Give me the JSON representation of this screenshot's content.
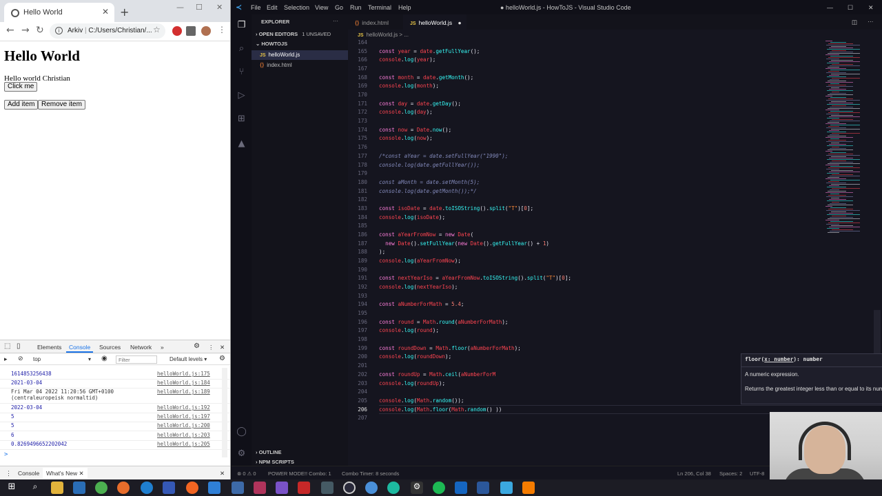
{
  "browser": {
    "tab_title": "Hello World",
    "address_prefix": "Arkiv",
    "address_separator": "|",
    "address_path": "C:/Users/Christian/...",
    "page": {
      "heading": "Hello World",
      "paragraph": "Hello world Christian",
      "click_button": "Click me",
      "add_button": "Add item",
      "remove_button": "Remove item"
    },
    "devtools": {
      "tabs": [
        "Elements",
        "Console",
        "Sources",
        "Network"
      ],
      "context": "top",
      "filter_placeholder": "Filter",
      "levels": "Default levels",
      "logs": [
        {
          "message": "1614853256438",
          "source": "helloWorld.js:175"
        },
        {
          "message": "2021-03-04",
          "source": "helloWorld.js:184"
        },
        {
          "message": "Fri Mar 04 2022 11:20:56 GMT+0100",
          "message2": "(centraleuropeisk normaltid)",
          "source": "helloWorld.js:189"
        },
        {
          "message": "2022-03-04",
          "source": "helloWorld.js:192"
        },
        {
          "message": "5",
          "source": "helloWorld.js:197"
        },
        {
          "message": "5",
          "source": "helloWorld.js:200"
        },
        {
          "message": "6",
          "source": "helloWorld.js:203"
        },
        {
          "message": "0.8269496652202042",
          "source": "helloWorld.js:205"
        }
      ],
      "prompt": ">",
      "drawer_tabs": [
        "Console",
        "What's New"
      ]
    }
  },
  "vscode": {
    "menu": [
      "File",
      "Edit",
      "Selection",
      "View",
      "Go",
      "Run",
      "Terminal",
      "Help"
    ],
    "title": "● helloWorld.js - HowToJS - Visual Studio Code",
    "sidebar": {
      "header": "EXPLORER",
      "open_editors": "OPEN EDITORS",
      "unsaved": "1 UNSAVED",
      "folder": "HOWTOJS",
      "files": [
        {
          "name": "helloWorld.js",
          "type": "JS"
        },
        {
          "name": "index.html",
          "type": "HTML"
        }
      ],
      "outline": "OUTLINE",
      "npm_scripts": "NPM SCRIPTS"
    },
    "tabs": [
      {
        "name": "index.html"
      },
      {
        "name": "helloWorld.js",
        "dirty": "●"
      }
    ],
    "breadcrumb": "helloWorld.js > ...",
    "hover": {
      "sig_pre": "floor(",
      "sig_param": "x: number",
      "sig_post": "): number",
      "param_desc": "A numeric expression.",
      "description": "Returns the greatest integer less than or equal to its numeric argument."
    },
    "status": {
      "errors": "⊗ 0 ⚠ 0",
      "power_mode": "POWER MODE!! Combo: 1",
      "combo_timer": "Combo Timer: 8 seconds",
      "position": "Ln 206, Col 38",
      "spaces": "Spaces: 2",
      "encoding": "UTF-8"
    }
  },
  "code_lines": [
    {
      "ln": "164",
      "t": []
    },
    {
      "ln": "165",
      "t": [
        [
          "kw",
          "const "
        ],
        [
          "vr",
          "year"
        ],
        [
          "tx",
          " = "
        ],
        [
          "vr",
          "date"
        ],
        [
          "tx",
          "."
        ],
        [
          "fn",
          "getFullYear"
        ],
        [
          "tx",
          "();"
        ]
      ]
    },
    {
      "ln": "166",
      "t": [
        [
          "vr",
          "console"
        ],
        [
          "tx",
          "."
        ],
        [
          "fn",
          "log"
        ],
        [
          "tx",
          "("
        ],
        [
          "vr",
          "year"
        ],
        [
          "tx",
          ");"
        ]
      ]
    },
    {
      "ln": "167",
      "t": []
    },
    {
      "ln": "168",
      "t": [
        [
          "kw",
          "const "
        ],
        [
          "vr",
          "month"
        ],
        [
          "tx",
          " = "
        ],
        [
          "vr",
          "date"
        ],
        [
          "tx",
          "."
        ],
        [
          "fn",
          "getMonth"
        ],
        [
          "tx",
          "();"
        ]
      ]
    },
    {
      "ln": "169",
      "t": [
        [
          "vr",
          "console"
        ],
        [
          "tx",
          "."
        ],
        [
          "fn",
          "log"
        ],
        [
          "tx",
          "("
        ],
        [
          "vr",
          "month"
        ],
        [
          "tx",
          ");"
        ]
      ]
    },
    {
      "ln": "170",
      "t": []
    },
    {
      "ln": "171",
      "t": [
        [
          "kw",
          "const "
        ],
        [
          "vr",
          "day"
        ],
        [
          "tx",
          " = "
        ],
        [
          "vr",
          "date"
        ],
        [
          "tx",
          "."
        ],
        [
          "fn",
          "getDay"
        ],
        [
          "tx",
          "();"
        ]
      ]
    },
    {
      "ln": "172",
      "t": [
        [
          "vr",
          "console"
        ],
        [
          "tx",
          "."
        ],
        [
          "fn",
          "log"
        ],
        [
          "tx",
          "("
        ],
        [
          "vr",
          "day"
        ],
        [
          "tx",
          ");"
        ]
      ]
    },
    {
      "ln": "173",
      "t": []
    },
    {
      "ln": "174",
      "t": [
        [
          "kw",
          "const "
        ],
        [
          "vr",
          "now"
        ],
        [
          "tx",
          " = "
        ],
        [
          "ty",
          "Date"
        ],
        [
          "tx",
          "."
        ],
        [
          "fn",
          "now"
        ],
        [
          "tx",
          "();"
        ]
      ]
    },
    {
      "ln": "175",
      "t": [
        [
          "vr",
          "console"
        ],
        [
          "tx",
          "."
        ],
        [
          "fn",
          "log"
        ],
        [
          "tx",
          "("
        ],
        [
          "vr",
          "now"
        ],
        [
          "tx",
          ");"
        ]
      ]
    },
    {
      "ln": "176",
      "t": []
    },
    {
      "ln": "177",
      "t": [
        [
          "cm",
          "/*const aYear = date.setFullYear(\"1990\");"
        ]
      ]
    },
    {
      "ln": "178",
      "t": [
        [
          "cm",
          "console.log(date.getFullYear());"
        ]
      ]
    },
    {
      "ln": "179",
      "t": []
    },
    {
      "ln": "180",
      "t": [
        [
          "cm",
          "const aMonth = date.setMonth(5);"
        ]
      ]
    },
    {
      "ln": "181",
      "t": [
        [
          "cm",
          "console.log(date.getMonth());*/"
        ]
      ]
    },
    {
      "ln": "182",
      "t": []
    },
    {
      "ln": "183",
      "t": [
        [
          "kw",
          "const "
        ],
        [
          "vr",
          "isoDate"
        ],
        [
          "tx",
          " = "
        ],
        [
          "vr",
          "date"
        ],
        [
          "tx",
          "."
        ],
        [
          "fn",
          "toISOString"
        ],
        [
          "tx",
          "()."
        ],
        [
          "fn",
          "split"
        ],
        [
          "tx",
          "("
        ],
        [
          "st",
          "\"T\""
        ],
        [
          "tx",
          ")["
        ],
        [
          "nm",
          "0"
        ],
        [
          "tx",
          "];"
        ]
      ]
    },
    {
      "ln": "184",
      "t": [
        [
          "vr",
          "console"
        ],
        [
          "tx",
          "."
        ],
        [
          "fn",
          "log"
        ],
        [
          "tx",
          "("
        ],
        [
          "vr",
          "isoDate"
        ],
        [
          "tx",
          ");"
        ]
      ]
    },
    {
      "ln": "185",
      "t": []
    },
    {
      "ln": "186",
      "t": [
        [
          "kw",
          "const "
        ],
        [
          "vr",
          "aYearFromNow"
        ],
        [
          "tx",
          " = "
        ],
        [
          "kw",
          "new "
        ],
        [
          "ty",
          "Date"
        ],
        [
          "tx",
          "("
        ]
      ]
    },
    {
      "ln": "187",
      "t": [
        [
          "tx",
          "  "
        ],
        [
          "kw",
          "new "
        ],
        [
          "ty",
          "Date"
        ],
        [
          "tx",
          "()."
        ],
        [
          "fn",
          "setFullYear"
        ],
        [
          "tx",
          "("
        ],
        [
          "kw",
          "new "
        ],
        [
          "ty",
          "Date"
        ],
        [
          "tx",
          "()."
        ],
        [
          "fn",
          "getFullYear"
        ],
        [
          "tx",
          "() + "
        ],
        [
          "nm",
          "1"
        ],
        [
          "tx",
          ")"
        ]
      ]
    },
    {
      "ln": "188",
      "t": [
        [
          "tx",
          ");"
        ]
      ]
    },
    {
      "ln": "189",
      "t": [
        [
          "vr",
          "console"
        ],
        [
          "tx",
          "."
        ],
        [
          "fn",
          "log"
        ],
        [
          "tx",
          "("
        ],
        [
          "vr",
          "aYearFromNow"
        ],
        [
          "tx",
          ");"
        ]
      ]
    },
    {
      "ln": "190",
      "t": []
    },
    {
      "ln": "191",
      "t": [
        [
          "kw",
          "const "
        ],
        [
          "vr",
          "nextYearIso"
        ],
        [
          "tx",
          " = "
        ],
        [
          "vr",
          "aYearFromNow"
        ],
        [
          "tx",
          "."
        ],
        [
          "fn",
          "toISOString"
        ],
        [
          "tx",
          "()."
        ],
        [
          "fn",
          "split"
        ],
        [
          "tx",
          "("
        ],
        [
          "st",
          "\"T\""
        ],
        [
          "tx",
          ")["
        ],
        [
          "nm",
          "0"
        ],
        [
          "tx",
          "];"
        ]
      ]
    },
    {
      "ln": "192",
      "t": [
        [
          "vr",
          "console"
        ],
        [
          "tx",
          "."
        ],
        [
          "fn",
          "log"
        ],
        [
          "tx",
          "("
        ],
        [
          "vr",
          "nextYearIso"
        ],
        [
          "tx",
          ");"
        ]
      ]
    },
    {
      "ln": "193",
      "t": []
    },
    {
      "ln": "194",
      "t": [
        [
          "kw",
          "const "
        ],
        [
          "vr",
          "aNumberForMath"
        ],
        [
          "tx",
          " = "
        ],
        [
          "nm",
          "5.4"
        ],
        [
          "tx",
          ";"
        ]
      ]
    },
    {
      "ln": "195",
      "t": []
    },
    {
      "ln": "196",
      "t": [
        [
          "kw",
          "const "
        ],
        [
          "vr",
          "round"
        ],
        [
          "tx",
          " = "
        ],
        [
          "ty",
          "Math"
        ],
        [
          "tx",
          "."
        ],
        [
          "fn",
          "round"
        ],
        [
          "tx",
          "("
        ],
        [
          "vr",
          "aNumberForMath"
        ],
        [
          "tx",
          ");"
        ]
      ]
    },
    {
      "ln": "197",
      "t": [
        [
          "vr",
          "console"
        ],
        [
          "tx",
          "."
        ],
        [
          "fn",
          "log"
        ],
        [
          "tx",
          "("
        ],
        [
          "vr",
          "round"
        ],
        [
          "tx",
          ");"
        ]
      ]
    },
    {
      "ln": "198",
      "t": []
    },
    {
      "ln": "199",
      "t": [
        [
          "kw",
          "const "
        ],
        [
          "vr",
          "roundDown"
        ],
        [
          "tx",
          " = "
        ],
        [
          "ty",
          "Math"
        ],
        [
          "tx",
          "."
        ],
        [
          "fn",
          "floor"
        ],
        [
          "tx",
          "("
        ],
        [
          "vr",
          "aNumberForMath"
        ],
        [
          "tx",
          ");"
        ]
      ]
    },
    {
      "ln": "200",
      "t": [
        [
          "vr",
          "console"
        ],
        [
          "tx",
          "."
        ],
        [
          "fn",
          "log"
        ],
        [
          "tx",
          "("
        ],
        [
          "vr",
          "roundDown"
        ],
        [
          "tx",
          ");"
        ]
      ]
    },
    {
      "ln": "201",
      "t": []
    },
    {
      "ln": "202",
      "t": [
        [
          "kw",
          "const "
        ],
        [
          "vr",
          "roundUp"
        ],
        [
          "tx",
          " = "
        ],
        [
          "ty",
          "Math"
        ],
        [
          "tx",
          "."
        ],
        [
          "fn",
          "ceil"
        ],
        [
          "tx",
          "("
        ],
        [
          "vr",
          "aNumberForM"
        ]
      ]
    },
    {
      "ln": "203",
      "t": [
        [
          "vr",
          "console"
        ],
        [
          "tx",
          "."
        ],
        [
          "fn",
          "log"
        ],
        [
          "tx",
          "("
        ],
        [
          "vr",
          "roundUp"
        ],
        [
          "tx",
          ");"
        ]
      ]
    },
    {
      "ln": "204",
      "t": []
    },
    {
      "ln": "205",
      "t": [
        [
          "vr",
          "console"
        ],
        [
          "tx",
          "."
        ],
        [
          "fn",
          "log"
        ],
        [
          "tx",
          "("
        ],
        [
          "ty",
          "Math"
        ],
        [
          "tx",
          "."
        ],
        [
          "fn",
          "random"
        ],
        [
          "tx",
          "());"
        ]
      ]
    },
    {
      "ln": "206",
      "t": [
        [
          "vr",
          "console"
        ],
        [
          "tx",
          "."
        ],
        [
          "fn",
          "log"
        ],
        [
          "tx",
          "("
        ],
        [
          "ty",
          "Math"
        ],
        [
          "tx",
          "."
        ],
        [
          "fn",
          "floor"
        ],
        [
          "tx",
          "("
        ],
        [
          "ty",
          "Math"
        ],
        [
          "tx",
          "."
        ],
        [
          "fn",
          "random"
        ],
        [
          "tx",
          "() ))"
        ]
      ]
    },
    {
      "ln": "207",
      "t": []
    }
  ],
  "colors": {
    "editor_bg": "#15151f",
    "keyword": "#ff7edb",
    "variable": "#fe4450",
    "function": "#36f9f6"
  }
}
